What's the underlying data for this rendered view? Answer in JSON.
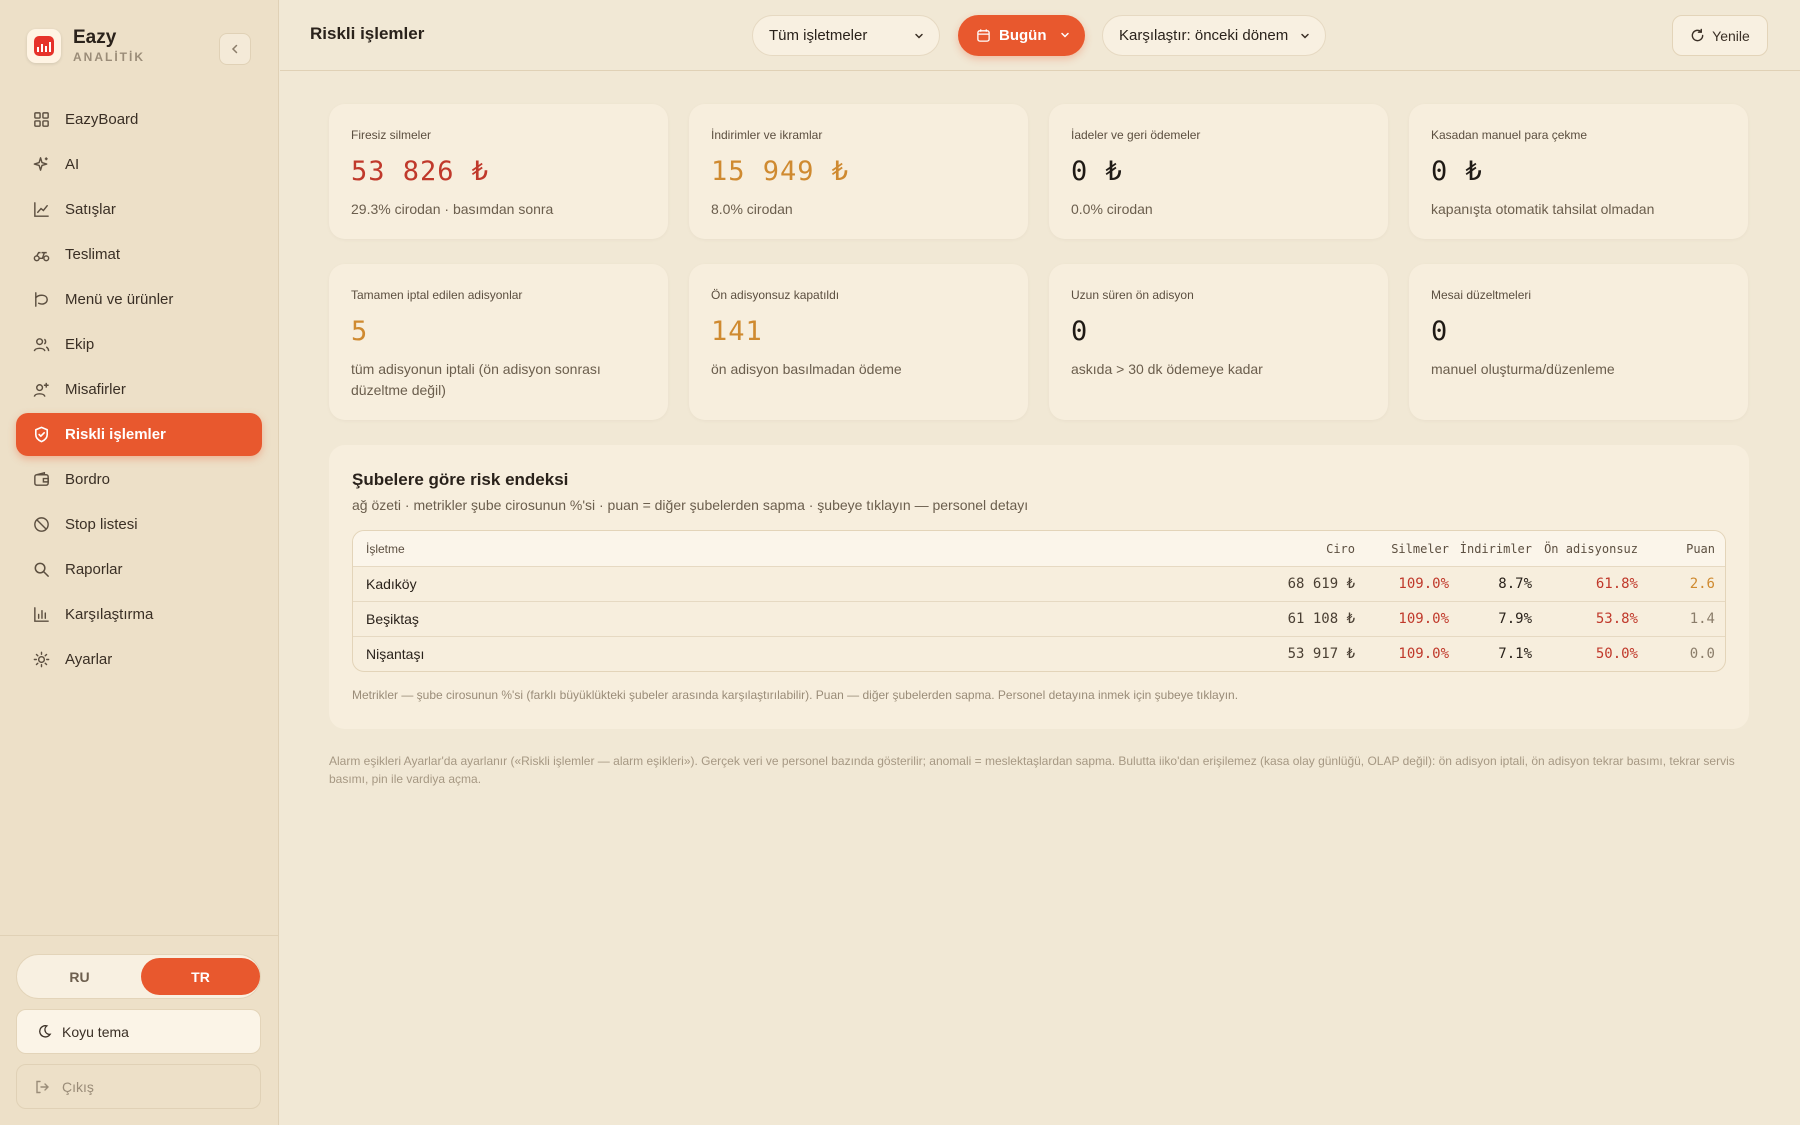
{
  "brand": {
    "name": "Eazy",
    "subtitle": "ANALİTİK"
  },
  "sidebar": {
    "items": [
      {
        "label": "EazyBoard",
        "icon": "grid-icon"
      },
      {
        "label": "AI",
        "icon": "sparkle-icon"
      },
      {
        "label": "Satışlar",
        "icon": "chart-line-icon"
      },
      {
        "label": "Teslimat",
        "icon": "scooter-icon"
      },
      {
        "label": "Menü ve ürünler",
        "icon": "cup-icon"
      },
      {
        "label": "Ekip",
        "icon": "users-icon"
      },
      {
        "label": "Misafirler",
        "icon": "user-plus-icon"
      },
      {
        "label": "Riskli işlemler",
        "icon": "shield-check-icon",
        "active": true
      },
      {
        "label": "Bordro",
        "icon": "wallet-icon"
      },
      {
        "label": "Stop listesi",
        "icon": "ban-icon"
      },
      {
        "label": "Raporlar",
        "icon": "search-icon"
      },
      {
        "label": "Karşılaştırma",
        "icon": "bar-chart-icon"
      },
      {
        "label": "Ayarlar",
        "icon": "sun-gear-icon"
      }
    ],
    "lang": {
      "ru": "RU",
      "tr": "TR",
      "active": "TR"
    },
    "theme_label": "Koyu tema",
    "logout_label": "Çıkış"
  },
  "header": {
    "title": "Riskli işlemler",
    "venue_select": "Tüm işletmeler",
    "period_button": "Bugün",
    "compare_select": "Karşılaştır: önceki dönem",
    "refresh_label": "Yenile"
  },
  "cards": [
    {
      "label": "Firesiz silmeler",
      "value": "53 826 ₺",
      "sub": "29.3% cirodan · basımdan sonra",
      "tone": "red"
    },
    {
      "label": "İndirimler ve ikramlar",
      "value": "15 949 ₺",
      "sub": "8.0% cirodan",
      "tone": "amber"
    },
    {
      "label": "İadeler ve geri ödemeler",
      "value": "0 ₺",
      "sub": "0.0% cirodan",
      "tone": "black"
    },
    {
      "label": "Kasadan manuel para çekme",
      "value": "0 ₺",
      "sub": "kapanışta otomatik tahsilat olmadan",
      "tone": "black"
    },
    {
      "label": "Tamamen iptal edilen adisyonlar",
      "value": "5",
      "sub": "tüm adisyonun iptali (ön adisyon sonrası düzeltme değil)",
      "tone": "amber"
    },
    {
      "label": "Ön adisyonsuz kapatıldı",
      "value": "141",
      "sub": "ön adisyon basılmadan ödeme",
      "tone": "amber"
    },
    {
      "label": "Uzun süren ön adisyon",
      "value": "0",
      "sub": "askıda > 30 dk ödemeye kadar",
      "tone": "black"
    },
    {
      "label": "Mesai düzeltmeleri",
      "value": "0",
      "sub": "manuel oluşturma/düzenleme",
      "tone": "black"
    }
  ],
  "risk": {
    "title": "Şubelere göre risk endeksi",
    "subtitle": "ağ özeti · metrikler şube cirosunun %'si · puan = diğer şubelerden sapma · şubeye tıklayın — personel detayı",
    "columns": {
      "name": "İşletme",
      "ciro": "Ciro",
      "silmeler": "Silmeler",
      "indirimler": "İndirimler",
      "onadisyonsuz": "Ön adisyonsuz",
      "puan": "Puan"
    },
    "rows": [
      {
        "name": "Kadıköy",
        "ciro": "68 619 ₺",
        "silmeler": "109.0%",
        "indirimler": "8.7%",
        "onadisyonsuz": "61.8%",
        "puan": "2.6"
      },
      {
        "name": "Beşiktaş",
        "ciro": "61 108 ₺",
        "silmeler": "109.0%",
        "indirimler": "7.9%",
        "onadisyonsuz": "53.8%",
        "puan": "1.4"
      },
      {
        "name": "Nişantaşı",
        "ciro": "53 917 ₺",
        "silmeler": "109.0%",
        "indirimler": "7.1%",
        "onadisyonsuz": "50.0%",
        "puan": "0.0"
      }
    ],
    "note": "Metrikler — şube cirosunun %'si (farklı büyüklükteki şubeler arasında karşılaştırılabilir). Puan — diğer şubelerden sapma. Personel detayına inmek için şubeye tıklayın."
  },
  "footnote": "Alarm eşikleri Ayarlar'da ayarlanır («Riskli işlemler — alarm eşikleri»). Gerçek veri ve personel bazında gösterilir; anomali = meslektaşlardan sapma. Bulutta iiko'dan erişilemez (kasa olay günlüğü, OLAP değil): ön adisyon iptali, ön adisyon tekrar basımı, tekrar servis basımı, pin ile vardiya açma.",
  "colors": {
    "accent": "#e8582e",
    "red": "#c0392b",
    "amber": "#cf8a30",
    "background": "#f1e8d5",
    "sidebar": "#ede0c8",
    "card": "#f7eedd"
  }
}
